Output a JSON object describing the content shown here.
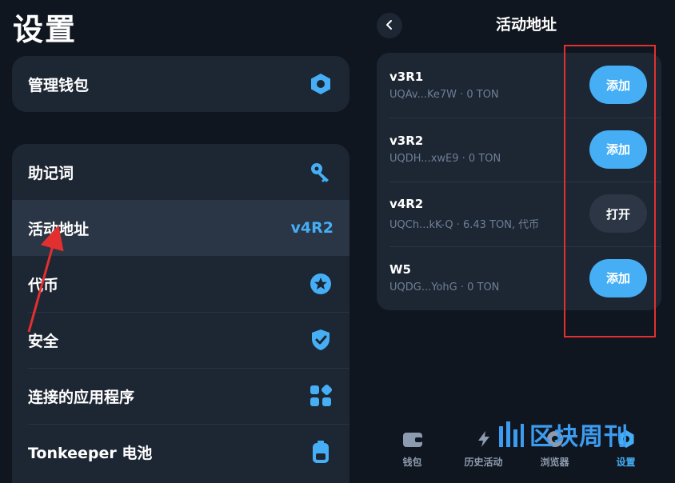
{
  "left": {
    "title": "设置",
    "manage_wallet": {
      "label": "管理钱包",
      "icon": "hexagon-settings-icon"
    },
    "items": [
      {
        "label": "助记词",
        "icon": "key-icon"
      },
      {
        "label": "活动地址",
        "badge": "v4R2"
      },
      {
        "label": "代币",
        "icon": "star-circle-icon"
      },
      {
        "label": "安全",
        "icon": "shield-check-icon"
      },
      {
        "label": "连接的应用程序",
        "icon": "apps-grid-icon"
      },
      {
        "label": "Tonkeeper 电池",
        "icon": "battery-icon"
      }
    ]
  },
  "right": {
    "title": "活动地址",
    "wallets": [
      {
        "name": "v3R1",
        "detail": "UQAv...Ke7W · 0 TON",
        "action": "添加"
      },
      {
        "name": "v3R2",
        "detail": "UQDH...xwE9 · 0 TON",
        "action": "添加"
      },
      {
        "name": "v4R2",
        "detail": "UQCh...kK-Q · 6.43 TON, 代币",
        "action": "打开"
      },
      {
        "name": "W5",
        "detail": "UQDG...YohG · 0 TON",
        "action": "添加"
      }
    ],
    "tabs": [
      {
        "label": "钱包",
        "icon": "wallet-icon"
      },
      {
        "label": "历史活动",
        "icon": "lightning-icon"
      },
      {
        "label": "浏览器",
        "icon": "compass-icon"
      },
      {
        "label": "设置",
        "icon": "gear-icon"
      }
    ]
  },
  "watermark": "区块周刊",
  "colors": {
    "background": "#10161f",
    "card": "#1d2633",
    "accent": "#45aef5",
    "annotation": "#e23030"
  }
}
